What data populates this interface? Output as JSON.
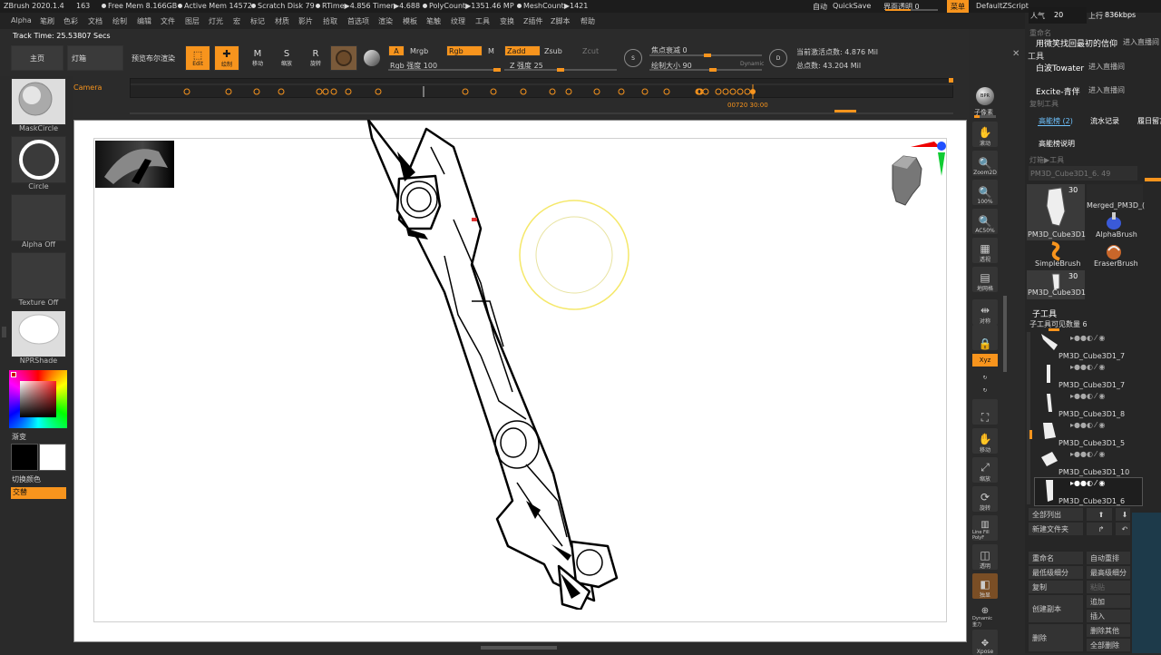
{
  "topbar": {
    "app": "ZBrush 2020.1.4",
    "num": "163",
    "free_mem": "Free Mem 8.166GB",
    "active_mem": "Active Mem 14572",
    "scratch": "Scratch Disk 79",
    "rtime": "RTime▶4.856 Timer▶4.688",
    "polycount": "PolyCount▶1351.46 MP",
    "meshcount": "MeshCount▶1421",
    "auto": "自动",
    "quicksave": "QuickSave",
    "transparency": "界面透明 0",
    "menu": "菜单",
    "script": "DefaultZScript",
    "popularity": "人气",
    "pop_value": "20",
    "upload": "上行",
    "upload_value": "836kbps"
  },
  "menubar": [
    "Alpha",
    "笔刷",
    "色彩",
    "文档",
    "绘制",
    "编辑",
    "文件",
    "图层",
    "灯光",
    "宏",
    "标记",
    "材质",
    "影片",
    "拾取",
    "首选项",
    "渲染",
    "模板",
    "笔触",
    "纹理",
    "工具",
    "变换",
    "Z插件",
    "Z脚本",
    "帮助"
  ],
  "shelf": {
    "track_time": "Track Time: 25.53807 Secs",
    "home": "主页",
    "lightbox": "灯箱",
    "bpr": "预览布尔渲染",
    "edit": "Edit",
    "draw": "绘制",
    "move": "移动",
    "scale": "缩放",
    "rotate": "旋转",
    "a_label": "A",
    "mrgb": "Mrgb",
    "rgb": "Rgb",
    "m": "M",
    "zadd": "Zadd",
    "zsub": "Zsub",
    "zcut": "Zcut",
    "rgb_intensity": "Rgb 强度 100",
    "z_intensity": "Z 强度 25",
    "focal_shift": "焦点衰减 0",
    "draw_size": "绘制大小 90",
    "dynamic": "Dynamic",
    "active_points": "当前激活点数: 4.876 Mil",
    "total_points": "总点数: 43.204 Mil",
    "camera": "Camera",
    "timeline_time": "00720 30:00"
  },
  "left": {
    "maskcircle": "MaskCircle",
    "circle": "Circle",
    "alpha_off": "Alpha Off",
    "texture_off": "Texture Off",
    "npr": "NPRShade",
    "gradient": "渐变",
    "switch_color": "切换颜色",
    "alternate": "交替"
  },
  "right_shelf": [
    "BPR",
    "子像素",
    "滚动",
    "Zoom2D",
    "100%",
    "AC50%",
    "透视",
    "地网格",
    "对称",
    "",
    "Xyz",
    "",
    "",
    "移动",
    "缩放",
    "旋转",
    "Line Fill PolyF",
    "透明",
    "独显",
    "Dynamic 重力",
    "Xpose"
  ],
  "chat": {
    "line1": "用微笑找回最初的信仰",
    "line1b": "进入直播间",
    "line2": "白波Towater",
    "line2b": "进入直播间",
    "line3": "Excite-青伴",
    "line3b": "进入直播间"
  },
  "rightpanel": {
    "tool_title": "工具",
    "rename": "重命名",
    "copy": "复制工具",
    "gonneng": "高能榜 (2)",
    "liushui": "流水记录",
    "luori": "履日留言",
    "gonneng_desc": "高能榜说明",
    "lightbox_tool": "灯箱▶工具",
    "current_tool": "PM3D_Cube3D1_6. 49",
    "thumb1_name": "PM3D_Cube3D1",
    "thumb1_count": "30",
    "thumb2_name": "Merged_PM3D_(",
    "alphabrush": "AlphaBrush",
    "simplebrush": "SimpleBrush",
    "eraserbrush": "EraserBrush",
    "thumb3_name": "PM3D_Cube3D1",
    "thumb3_count": "30",
    "subtool_title": "子工具",
    "subtool_visible": "子工具可见数量 6",
    "subtools": [
      "PM3D_Cube3D1_7",
      "PM3D_Cube3D1_7",
      "PM3D_Cube3D1_8",
      "PM3D_Cube3D1_5",
      "PM3D_Cube3D1_10",
      "PM3D_Cube3D1_6"
    ],
    "list_all": "全部列出",
    "new_folder": "新建文件夹",
    "rename_btn": "重命名",
    "auto_reorder": "自动重排",
    "lowest_sub": "最低级细分",
    "highest_sub": "最高级细分",
    "copy_btn": "复制",
    "paste": "粘贴",
    "create_copy": "创建副本",
    "add": "追加",
    "insert": "插入",
    "delete": "删除",
    "delete_other": "删除其他",
    "delete_all": "全部删除"
  }
}
